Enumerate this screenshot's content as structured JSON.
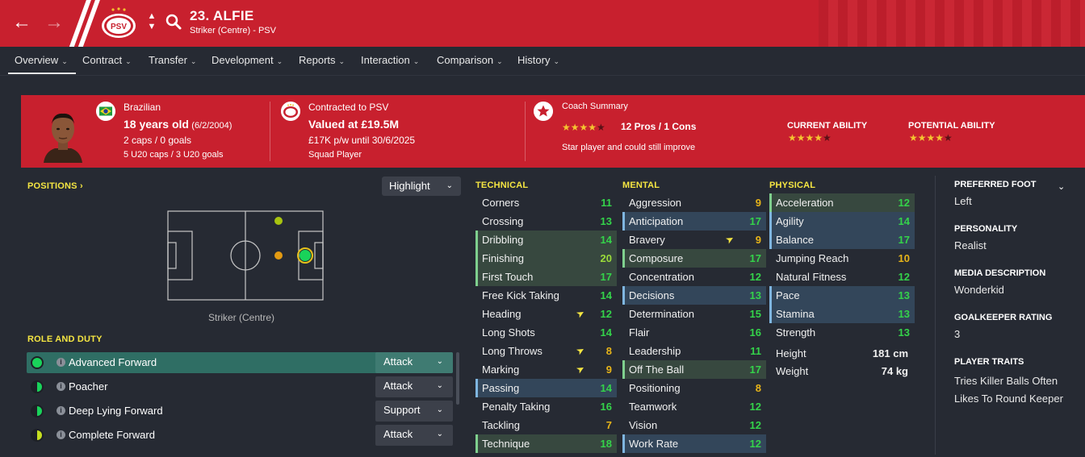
{
  "header": {
    "player_name": "23. ALFIE",
    "player_role": "Striker (Centre) - PSV",
    "club_badge_text": "PSV",
    "icons": {
      "back": "back-arrow-icon",
      "forward": "forward-arrow-icon",
      "search": "search-icon"
    },
    "brand_color": "#c8202e"
  },
  "tabs": [
    "Overview",
    "Contract",
    "Transfer",
    "Development",
    "Reports",
    "Interaction",
    "Comparison",
    "History"
  ],
  "banner": {
    "nationality": "Brazilian",
    "age": "18 years old",
    "dob": "(6/2/2004)",
    "caps": "2 caps / 0 goals",
    "u20": "5 U20 caps / 3 U20 goals",
    "contracted": "Contracted to PSV",
    "valued": "Valued at £19.5M",
    "wage": "£17K p/w until 30/6/2025",
    "squad_status": "Squad Player",
    "coach_summary_title": "Coach Summary",
    "pros_cons": "12 Pros / 1 Cons",
    "coach_summary_stars": 4.5,
    "coach_summary_text": "Star player and could still improve",
    "current_ability_label": "CURRENT ABILITY",
    "current_ability_stars": 4.5,
    "potential_ability_label": "POTENTIAL ABILITY",
    "potential_ability_stars": 4.5
  },
  "positions": {
    "title": "POSITIONS",
    "highlight_label": "Highlight",
    "caption": "Striker (Centre)"
  },
  "role_and_duty": {
    "title": "ROLE AND DUTY",
    "roles": [
      {
        "name": "Advanced Forward",
        "duty": "Attack"
      },
      {
        "name": "Poacher",
        "duty": "Attack"
      },
      {
        "name": "Deep Lying Forward",
        "duty": "Support"
      },
      {
        "name": "Complete Forward",
        "duty": "Attack"
      }
    ]
  },
  "technical": {
    "title": "TECHNICAL",
    "attrs": [
      {
        "name": "Corners",
        "value": "11"
      },
      {
        "name": "Crossing",
        "value": "13"
      },
      {
        "name": "Dribbling",
        "value": "14"
      },
      {
        "name": "Finishing",
        "value": "20"
      },
      {
        "name": "First Touch",
        "value": "17"
      },
      {
        "name": "Free Kick Taking",
        "value": "14"
      },
      {
        "name": "Heading",
        "value": "12"
      },
      {
        "name": "Long Shots",
        "value": "14"
      },
      {
        "name": "Long Throws",
        "value": "8"
      },
      {
        "name": "Marking",
        "value": "9"
      },
      {
        "name": "Passing",
        "value": "14"
      },
      {
        "name": "Penalty Taking",
        "value": "16"
      },
      {
        "name": "Tackling",
        "value": "7"
      },
      {
        "name": "Technique",
        "value": "18"
      }
    ]
  },
  "mental": {
    "title": "MENTAL",
    "attrs": [
      {
        "name": "Aggression",
        "value": "9"
      },
      {
        "name": "Anticipation",
        "value": "17"
      },
      {
        "name": "Bravery",
        "value": "9"
      },
      {
        "name": "Composure",
        "value": "17"
      },
      {
        "name": "Concentration",
        "value": "12"
      },
      {
        "name": "Decisions",
        "value": "13"
      },
      {
        "name": "Determination",
        "value": "15"
      },
      {
        "name": "Flair",
        "value": "16"
      },
      {
        "name": "Leadership",
        "value": "11"
      },
      {
        "name": "Off The Ball",
        "value": "17"
      },
      {
        "name": "Positioning",
        "value": "8"
      },
      {
        "name": "Teamwork",
        "value": "12"
      },
      {
        "name": "Vision",
        "value": "12"
      },
      {
        "name": "Work Rate",
        "value": "12"
      }
    ]
  },
  "physical": {
    "title": "PHYSICAL",
    "attrs": [
      {
        "name": "Acceleration",
        "value": "12"
      },
      {
        "name": "Agility",
        "value": "14"
      },
      {
        "name": "Balance",
        "value": "17"
      },
      {
        "name": "Jumping Reach",
        "value": "10"
      },
      {
        "name": "Natural Fitness",
        "value": "12"
      },
      {
        "name": "Pace",
        "value": "13"
      },
      {
        "name": "Stamina",
        "value": "13"
      },
      {
        "name": "Strength",
        "value": "13"
      }
    ],
    "height_label": "Height",
    "height": "181 cm",
    "weight_label": "Weight",
    "weight": "74 kg"
  },
  "profile": {
    "preferred_foot_label": "PREFERRED FOOT",
    "preferred_foot": "Left",
    "personality_label": "PERSONALITY",
    "personality": "Realist",
    "media_label": "MEDIA DESCRIPTION",
    "media": "Wonderkid",
    "gk_label": "GOALKEEPER RATING",
    "gk": "3",
    "traits_label": "PLAYER TRAITS",
    "traits": [
      "Tries Killer Balls Often",
      "Likes To Round Keeper"
    ]
  }
}
